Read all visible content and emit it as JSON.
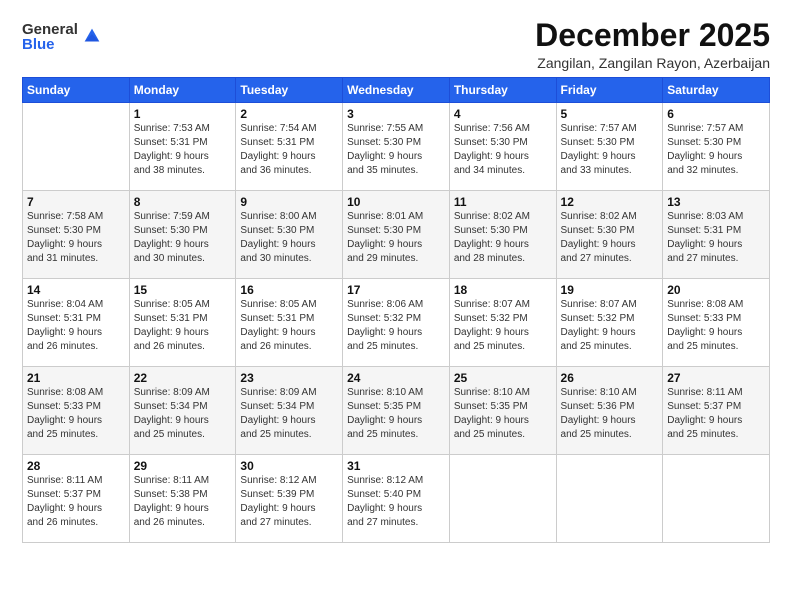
{
  "logo": {
    "general": "General",
    "blue": "Blue"
  },
  "header": {
    "month": "December 2025",
    "location": "Zangilan, Zangilan Rayon, Azerbaijan"
  },
  "weekdays": [
    "Sunday",
    "Monday",
    "Tuesday",
    "Wednesday",
    "Thursday",
    "Friday",
    "Saturday"
  ],
  "weeks": [
    [
      {
        "day": "",
        "info": ""
      },
      {
        "day": "1",
        "info": "Sunrise: 7:53 AM\nSunset: 5:31 PM\nDaylight: 9 hours\nand 38 minutes."
      },
      {
        "day": "2",
        "info": "Sunrise: 7:54 AM\nSunset: 5:31 PM\nDaylight: 9 hours\nand 36 minutes."
      },
      {
        "day": "3",
        "info": "Sunrise: 7:55 AM\nSunset: 5:30 PM\nDaylight: 9 hours\nand 35 minutes."
      },
      {
        "day": "4",
        "info": "Sunrise: 7:56 AM\nSunset: 5:30 PM\nDaylight: 9 hours\nand 34 minutes."
      },
      {
        "day": "5",
        "info": "Sunrise: 7:57 AM\nSunset: 5:30 PM\nDaylight: 9 hours\nand 33 minutes."
      },
      {
        "day": "6",
        "info": "Sunrise: 7:57 AM\nSunset: 5:30 PM\nDaylight: 9 hours\nand 32 minutes."
      }
    ],
    [
      {
        "day": "7",
        "info": "Sunrise: 7:58 AM\nSunset: 5:30 PM\nDaylight: 9 hours\nand 31 minutes."
      },
      {
        "day": "8",
        "info": "Sunrise: 7:59 AM\nSunset: 5:30 PM\nDaylight: 9 hours\nand 30 minutes."
      },
      {
        "day": "9",
        "info": "Sunrise: 8:00 AM\nSunset: 5:30 PM\nDaylight: 9 hours\nand 30 minutes."
      },
      {
        "day": "10",
        "info": "Sunrise: 8:01 AM\nSunset: 5:30 PM\nDaylight: 9 hours\nand 29 minutes."
      },
      {
        "day": "11",
        "info": "Sunrise: 8:02 AM\nSunset: 5:30 PM\nDaylight: 9 hours\nand 28 minutes."
      },
      {
        "day": "12",
        "info": "Sunrise: 8:02 AM\nSunset: 5:30 PM\nDaylight: 9 hours\nand 27 minutes."
      },
      {
        "day": "13",
        "info": "Sunrise: 8:03 AM\nSunset: 5:31 PM\nDaylight: 9 hours\nand 27 minutes."
      }
    ],
    [
      {
        "day": "14",
        "info": "Sunrise: 8:04 AM\nSunset: 5:31 PM\nDaylight: 9 hours\nand 26 minutes."
      },
      {
        "day": "15",
        "info": "Sunrise: 8:05 AM\nSunset: 5:31 PM\nDaylight: 9 hours\nand 26 minutes."
      },
      {
        "day": "16",
        "info": "Sunrise: 8:05 AM\nSunset: 5:31 PM\nDaylight: 9 hours\nand 26 minutes."
      },
      {
        "day": "17",
        "info": "Sunrise: 8:06 AM\nSunset: 5:32 PM\nDaylight: 9 hours\nand 25 minutes."
      },
      {
        "day": "18",
        "info": "Sunrise: 8:07 AM\nSunset: 5:32 PM\nDaylight: 9 hours\nand 25 minutes."
      },
      {
        "day": "19",
        "info": "Sunrise: 8:07 AM\nSunset: 5:32 PM\nDaylight: 9 hours\nand 25 minutes."
      },
      {
        "day": "20",
        "info": "Sunrise: 8:08 AM\nSunset: 5:33 PM\nDaylight: 9 hours\nand 25 minutes."
      }
    ],
    [
      {
        "day": "21",
        "info": "Sunrise: 8:08 AM\nSunset: 5:33 PM\nDaylight: 9 hours\nand 25 minutes."
      },
      {
        "day": "22",
        "info": "Sunrise: 8:09 AM\nSunset: 5:34 PM\nDaylight: 9 hours\nand 25 minutes."
      },
      {
        "day": "23",
        "info": "Sunrise: 8:09 AM\nSunset: 5:34 PM\nDaylight: 9 hours\nand 25 minutes."
      },
      {
        "day": "24",
        "info": "Sunrise: 8:10 AM\nSunset: 5:35 PM\nDaylight: 9 hours\nand 25 minutes."
      },
      {
        "day": "25",
        "info": "Sunrise: 8:10 AM\nSunset: 5:35 PM\nDaylight: 9 hours\nand 25 minutes."
      },
      {
        "day": "26",
        "info": "Sunrise: 8:10 AM\nSunset: 5:36 PM\nDaylight: 9 hours\nand 25 minutes."
      },
      {
        "day": "27",
        "info": "Sunrise: 8:11 AM\nSunset: 5:37 PM\nDaylight: 9 hours\nand 25 minutes."
      }
    ],
    [
      {
        "day": "28",
        "info": "Sunrise: 8:11 AM\nSunset: 5:37 PM\nDaylight: 9 hours\nand 26 minutes."
      },
      {
        "day": "29",
        "info": "Sunrise: 8:11 AM\nSunset: 5:38 PM\nDaylight: 9 hours\nand 26 minutes."
      },
      {
        "day": "30",
        "info": "Sunrise: 8:12 AM\nSunset: 5:39 PM\nDaylight: 9 hours\nand 27 minutes."
      },
      {
        "day": "31",
        "info": "Sunrise: 8:12 AM\nSunset: 5:40 PM\nDaylight: 9 hours\nand 27 minutes."
      },
      {
        "day": "",
        "info": ""
      },
      {
        "day": "",
        "info": ""
      },
      {
        "day": "",
        "info": ""
      }
    ]
  ]
}
